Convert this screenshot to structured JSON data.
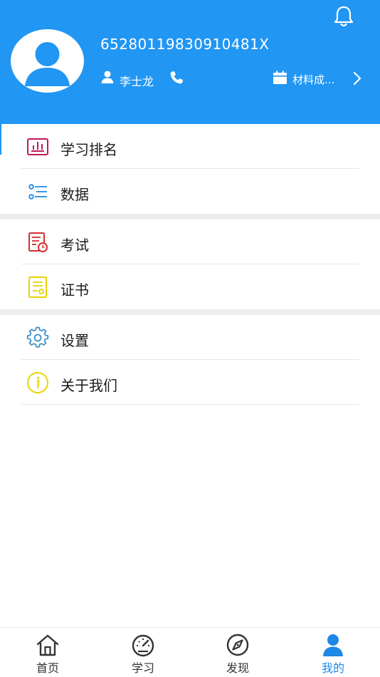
{
  "header": {
    "id_number": "65280119830910481X",
    "user_name": "李士龙",
    "company": "材料成..."
  },
  "menu": {
    "items": [
      {
        "label": "学习排名",
        "icon": "ranking-chart-icon",
        "color": "#c2185b"
      },
      {
        "label": "数据",
        "icon": "data-list-icon",
        "color": "#1e88e5"
      },
      {
        "label": "考试",
        "icon": "exam-doc-icon",
        "color": "#d32f2f"
      },
      {
        "label": "证书",
        "icon": "certificate-icon",
        "color": "#e6d400"
      },
      {
        "label": "设置",
        "icon": "settings-gear-icon",
        "color": "#3d8fc9"
      },
      {
        "label": "关于我们",
        "icon": "info-icon",
        "color": "#e6d400"
      }
    ]
  },
  "tabbar": {
    "tabs": [
      {
        "label": "首页",
        "icon": "home-icon"
      },
      {
        "label": "学习",
        "icon": "gauge-icon"
      },
      {
        "label": "发现",
        "icon": "compass-icon"
      },
      {
        "label": "我的",
        "icon": "person-icon",
        "active": true
      }
    ]
  },
  "colors": {
    "brand": "#2196f3",
    "tab_active": "#1e88e5"
  }
}
